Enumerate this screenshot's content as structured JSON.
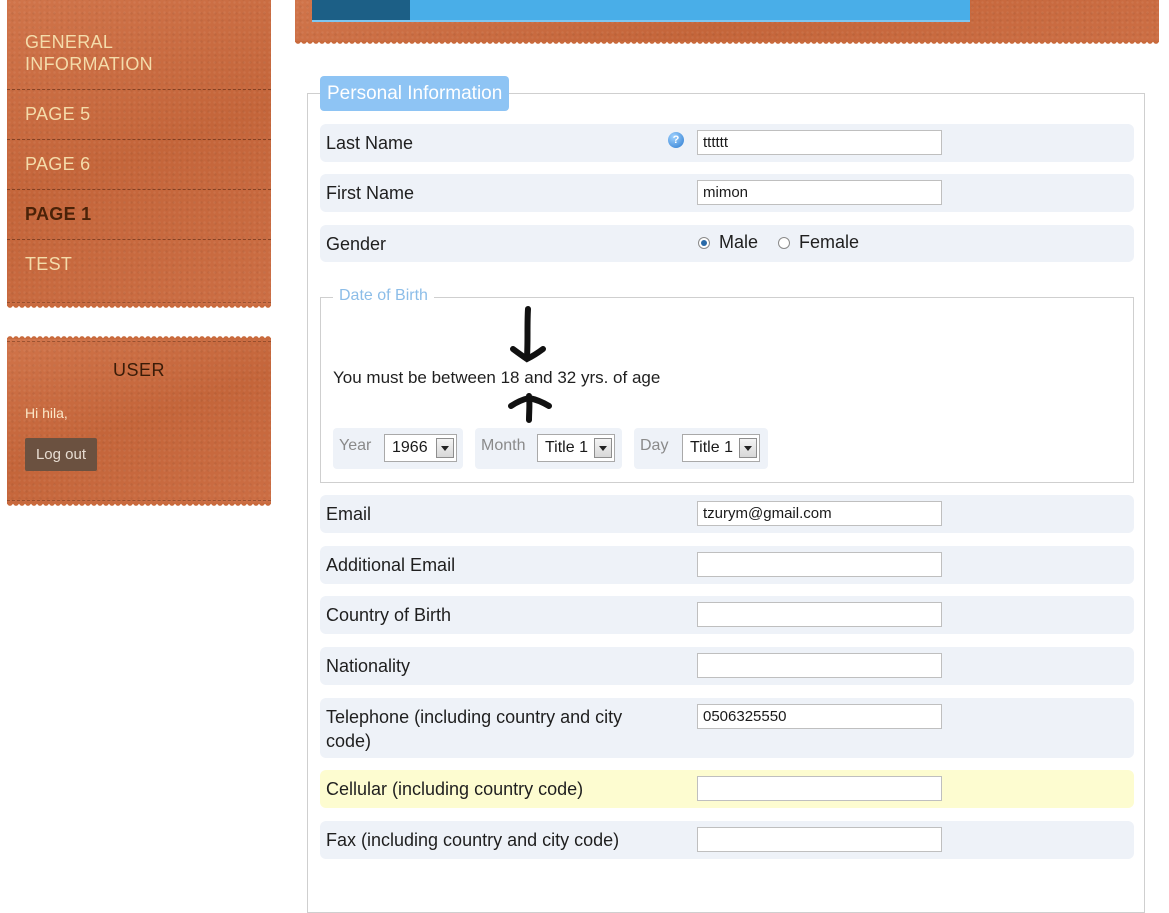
{
  "top_tabs": [
    "",
    "",
    "",
    "",
    "",
    ""
  ],
  "nav": {
    "items": [
      {
        "label": "GENERAL INFORMATION"
      },
      {
        "label": "PAGE 5"
      },
      {
        "label": "PAGE 6"
      },
      {
        "label": "PAGE 1",
        "active": true
      },
      {
        "label": "TEST"
      }
    ]
  },
  "user": {
    "title": "USER",
    "greeting": "Hi hila,",
    "logout_label": "Log out"
  },
  "form": {
    "section_title": "Personal Information",
    "last_name": {
      "label": "Last Name",
      "value": "tttttt"
    },
    "first_name": {
      "label": "First Name",
      "value": "mimon"
    },
    "gender": {
      "label": "Gender",
      "options": [
        "Male",
        "Female"
      ],
      "selected": "Male"
    },
    "dob": {
      "legend": "Date of Birth",
      "note": "You must be between 18 and 32 yrs. of age",
      "year": {
        "label": "Year",
        "value": "1966"
      },
      "month": {
        "label": "Month",
        "value": "Title 1"
      },
      "day": {
        "label": "Day",
        "value": "Title 1"
      }
    },
    "email": {
      "label": "Email",
      "value": "tzurym@gmail.com"
    },
    "additional_email": {
      "label": "Additional Email",
      "value": ""
    },
    "country_of_birth": {
      "label": "Country of Birth",
      "value": ""
    },
    "nationality": {
      "label": "Nationality",
      "value": ""
    },
    "telephone": {
      "label_line1": "Telephone (including country and city",
      "label_line2": "code)",
      "value": "0506325550"
    },
    "cellular": {
      "label": "Cellular (including country code)",
      "value": ""
    },
    "fax": {
      "label": "Fax (including country and city code)",
      "value": ""
    }
  },
  "colors": {
    "leather": "#c96a3c",
    "tab_active": "#1c5f86",
    "tab_bar": "#49aee8",
    "legend_bg": "#8ec4f4",
    "row_bg": "#eef2f8",
    "row_highlight": "#fdfcd0"
  }
}
